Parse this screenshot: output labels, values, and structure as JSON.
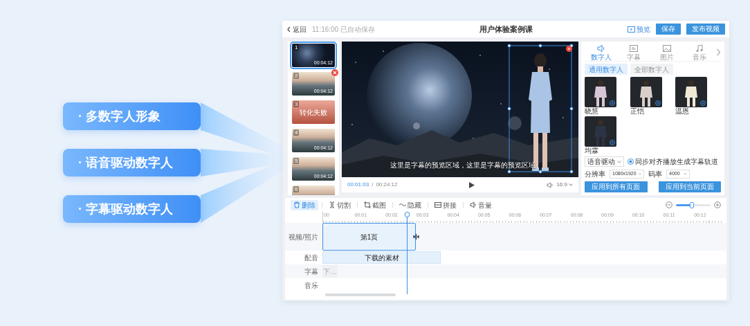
{
  "features": [
    "· 多数字人形象",
    "· 语音驱动数字人",
    "· 字幕驱动数字人"
  ],
  "header": {
    "back": "返回",
    "autosave": "11:16:00 已自动保存",
    "title": "用户体验案例课",
    "preview": "预览",
    "buttons": [
      "保存",
      "发布视频"
    ]
  },
  "scenes": [
    {
      "number": "1",
      "duration": "00:04:12",
      "kind": "scene",
      "selected": true,
      "delete_badge": false
    },
    {
      "number": "2",
      "duration": "00:04:12",
      "kind": "scene",
      "selected": false,
      "delete_badge": true
    },
    {
      "number": "3",
      "failure_text": "转化失败",
      "kind": "failed",
      "selected": false,
      "delete_badge": false
    },
    {
      "number": "4",
      "duration": "00:04:12",
      "kind": "scene",
      "selected": false,
      "delete_badge": false
    },
    {
      "number": "5",
      "duration": "00:04:12",
      "kind": "scene",
      "selected": false,
      "delete_badge": false
    },
    {
      "number": "6",
      "kind": "scene",
      "selected": false,
      "delete_badge": false
    }
  ],
  "player": {
    "subtitle": "这里是字幕的预览区域，这里是字幕的预览区域",
    "presenter_selected": true,
    "current_time": "00:01:03",
    "separator": "/",
    "total_time": "00:24:12",
    "aspect": "16:9"
  },
  "panel": {
    "tabs": [
      {
        "label": "数字人",
        "selected": true
      },
      {
        "label": "字幕",
        "selected": false
      },
      {
        "label": "图片",
        "selected": false
      },
      {
        "label": "音乐",
        "selected": false
      }
    ],
    "filters": [
      {
        "label": "通用数字人",
        "selected": true
      },
      {
        "label": "全部数字人",
        "selected": false
      }
    ],
    "avatars": [
      {
        "name": "晓慧"
      },
      {
        "name": "正恺"
      },
      {
        "name": "温恩"
      },
      {
        "name": "均霖"
      }
    ],
    "drive_mode": "语音驱动",
    "sync_subtitles": {
      "label": "同步对齐播放生成字幕轨道",
      "checked": true
    },
    "resolution": {
      "label": "分辨率",
      "value": "1080x1920"
    },
    "bitrate": {
      "label": "码率",
      "value": "4000"
    },
    "buttons": [
      "应用到所有页面",
      "应用到当前页面"
    ]
  },
  "toolbar": {
    "tools": [
      {
        "label": "删除",
        "selected": true
      },
      {
        "label": "切割",
        "selected": false
      },
      {
        "label": "截图",
        "selected": false
      },
      {
        "label": "隐藏",
        "selected": false
      },
      {
        "label": "拼接",
        "selected": false
      },
      {
        "label": "音量",
        "selected": false
      }
    ],
    "zoom": {
      "level": 0.45
    }
  },
  "timeline": {
    "ticks": [
      "00",
      "00:01",
      "00:02",
      "00:03",
      "00:04",
      "00:05",
      "00:06",
      "00:07",
      "00:08",
      "00:09",
      "00:10",
      "00:11",
      "00:12"
    ],
    "playhead": {
      "level": 0.21
    },
    "tracks": [
      {
        "label": "视频/照片",
        "kind": "video",
        "clip": "第1页"
      },
      {
        "label": "配音",
        "kind": "audio",
        "clip": "下载的素材"
      },
      {
        "label": "字幕",
        "kind": "subtitle",
        "clip": "下…"
      },
      {
        "label": "音乐",
        "kind": "music"
      }
    ]
  }
}
